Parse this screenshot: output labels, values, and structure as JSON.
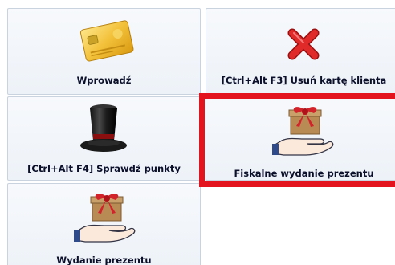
{
  "tiles": {
    "enter": {
      "label": "Wprowadź",
      "icon": "card-icon"
    },
    "remove_card": {
      "label": "[Ctrl+Alt F3] Usuń kartę klienta",
      "icon": "red-x-icon"
    },
    "check_points": {
      "label": "[Ctrl+Alt F4] Sprawdź punkty",
      "icon": "top-hat-icon"
    },
    "fiscal_gift": {
      "label": "Fiskalne wydanie prezentu",
      "icon": "gift-hand-icon"
    },
    "gift": {
      "label": "Wydanie prezentu",
      "icon": "gift-hand-icon"
    }
  },
  "highlight_color": "#e3141d"
}
